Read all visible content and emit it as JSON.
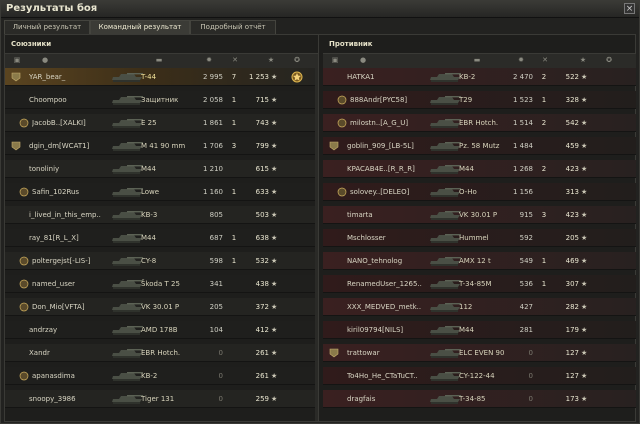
{
  "window": {
    "title": "Результаты боя"
  },
  "tabs": [
    "Личный результат",
    "Командный результат",
    "Подробный отчёт"
  ],
  "active_tab": 1,
  "colors": {
    "player_highlight": "#5a4420",
    "premium_tank": "#f2e39a"
  },
  "header_icons": [
    "platoon-icon",
    "player-icon",
    "tank-icon",
    "damage-icon",
    "frags-icon",
    "xp-icon",
    "medal-icon"
  ],
  "allies": {
    "title": "Союзники",
    "rows": [
      {
        "name": "YAR_bear_",
        "tank": "T-44",
        "damage": "2 995",
        "frags": "7",
        "xp": "1 253",
        "me": true,
        "platoon": true,
        "tank_color": "yellow",
        "badge": true
      },
      {
        "name": "Choompoo",
        "tank": "Защитник",
        "damage": "2 058",
        "frags": "1",
        "xp": "715"
      },
      {
        "name": "JacobB..[XALKI]",
        "tank": "E 25",
        "damage": "1 861",
        "frags": "1",
        "xp": "743",
        "clan_icon": true
      },
      {
        "name": "dgin_dm[WCAT1]",
        "tank": "M 41 90 mm",
        "damage": "1 706",
        "frags": "3",
        "xp": "799",
        "platoon": true
      },
      {
        "name": "tonoliniy",
        "tank": "M44",
        "damage": "1 210",
        "frags": "",
        "xp": "615"
      },
      {
        "name": "Safin_102Rus",
        "tank": "Lowe",
        "damage": "1 160",
        "frags": "1",
        "xp": "633",
        "clan_icon": true
      },
      {
        "name": "i_lived_in_this_emp..",
        "tank": "KB-3",
        "damage": "805",
        "frags": "",
        "xp": "503"
      },
      {
        "name": "ray_81[R_L_X]",
        "tank": "M44",
        "damage": "687",
        "frags": "1",
        "xp": "638"
      },
      {
        "name": "poltergejst[-LIS-]",
        "tank": "CY-8",
        "damage": "598",
        "frags": "1",
        "xp": "532",
        "clan_icon": true
      },
      {
        "name": "named_user",
        "tank": "Škoda T 25",
        "damage": "341",
        "frags": "",
        "xp": "438",
        "clan_icon": true
      },
      {
        "name": "Don_Mio[VFTA]",
        "tank": "VK 30.01 P",
        "damage": "205",
        "frags": "",
        "xp": "372",
        "clan_icon": true
      },
      {
        "name": "andrzay",
        "tank": "AMD 178B",
        "damage": "104",
        "frags": "",
        "xp": "412"
      },
      {
        "name": "Xandr",
        "tank": "EBR Hotch.",
        "damage": "0",
        "frags": "",
        "xp": "261"
      },
      {
        "name": "apanasdima",
        "tank": "KB-2",
        "damage": "0",
        "frags": "",
        "xp": "261",
        "clan_icon": true
      },
      {
        "name": "snoopy_3986",
        "tank": "Tiger 131",
        "damage": "0",
        "frags": "",
        "xp": "259"
      }
    ]
  },
  "enemies": {
    "title": "Противник",
    "rows": [
      {
        "name": "HATKA1",
        "tank": "KB-2",
        "damage": "2 470",
        "frags": "2",
        "xp": "522"
      },
      {
        "name": "888Andr[PYC58]",
        "tank": "T29",
        "damage": "1 523",
        "frags": "1",
        "xp": "328",
        "clan_icon": true
      },
      {
        "name": "milostn..[A_G_U]",
        "tank": "EBR Hotch.",
        "damage": "1 514",
        "frags": "2",
        "xp": "542",
        "clan_icon": true
      },
      {
        "name": "goblin_909_[LB-5L]",
        "tank": "Pz. 58 Mutz",
        "damage": "1 484",
        "frags": "",
        "xp": "459",
        "platoon": true
      },
      {
        "name": "KPACAB4E..[R_R_R]",
        "tank": "M44",
        "damage": "1 268",
        "frags": "2",
        "xp": "423"
      },
      {
        "name": "solovey..[DELEO]",
        "tank": "O-Ho",
        "damage": "1 156",
        "frags": "",
        "xp": "313",
        "clan_icon": true
      },
      {
        "name": "timarta",
        "tank": "VK 30.01 P",
        "damage": "915",
        "frags": "3",
        "xp": "423"
      },
      {
        "name": "Mschlosser",
        "tank": "Hummel",
        "damage": "592",
        "frags": "",
        "xp": "205"
      },
      {
        "name": "NANO_tehnolog",
        "tank": "AMX 12 t",
        "damage": "549",
        "frags": "1",
        "xp": "469"
      },
      {
        "name": "RenamedUser_1265..",
        "tank": "T-34-85M",
        "damage": "536",
        "frags": "1",
        "xp": "307"
      },
      {
        "name": "XXX_MEDVED_metk..",
        "tank": "112",
        "damage": "427",
        "frags": "",
        "xp": "282"
      },
      {
        "name": "kiril09794[NILS]",
        "tank": "M44",
        "damage": "281",
        "frags": "",
        "xp": "179"
      },
      {
        "name": "trattowar",
        "tank": "ELC EVEN 90",
        "damage": "0",
        "frags": "",
        "xp": "127",
        "platoon": true
      },
      {
        "name": "To4Ho_He_CTaTuCT..",
        "tank": "CY-122-44",
        "damage": "0",
        "frags": "",
        "xp": "127"
      },
      {
        "name": "dragfais",
        "tank": "T-34-85",
        "damage": "0",
        "frags": "",
        "xp": "173"
      }
    ]
  }
}
